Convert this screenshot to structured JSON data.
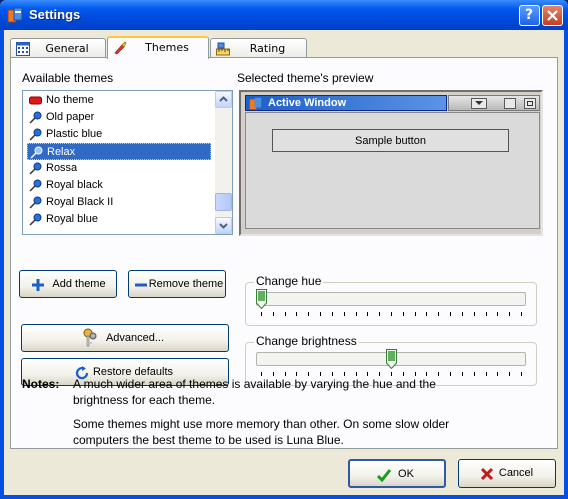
{
  "window": {
    "title": "Settings"
  },
  "tabs": [
    {
      "label": "General",
      "icon": "calendar-grid-icon",
      "active": false
    },
    {
      "label": "Themes",
      "icon": "paint-brush-icon",
      "active": true
    },
    {
      "label": "Rating",
      "icon": "ruler-icon",
      "active": false
    }
  ],
  "themes_panel": {
    "available_label": "Available themes",
    "preview_label": "Selected theme's preview",
    "items": [
      {
        "label": "No theme",
        "icon": "red-bar-icon"
      },
      {
        "label": "Old paper",
        "icon": "pushpin-icon"
      },
      {
        "label": "Plastic blue",
        "icon": "pushpin-icon"
      },
      {
        "label": "Relax",
        "icon": "pushpin-icon",
        "selected": true
      },
      {
        "label": "Rossa",
        "icon": "pushpin-icon"
      },
      {
        "label": "Royal black",
        "icon": "pushpin-icon"
      },
      {
        "label": "Royal Black II",
        "icon": "pushpin-icon"
      },
      {
        "label": "Royal blue",
        "icon": "pushpin-icon"
      }
    ],
    "add_button": "Add theme",
    "remove_button": "Remove theme",
    "advanced_button": "Advanced...",
    "restore_button": "Restore defaults",
    "preview": {
      "window_title": "Active Window",
      "sample_button": "Sample button"
    },
    "hue": {
      "label": "Change hue",
      "value_fraction": 0.0
    },
    "brightness": {
      "label": "Change brightness",
      "value_fraction": 0.5
    }
  },
  "notes": {
    "heading": "Notes:",
    "paragraphs": [
      "A much wider area of themes is available by varying the hue and the brightness for each theme.",
      "Some themes might use more memory than other. On some slow older computers the best theme to be used is Luna Blue."
    ]
  },
  "footer": {
    "ok": "OK",
    "cancel": "Cancel"
  },
  "colors": {
    "titlebar": "#0058ee",
    "selection": "#316ac5",
    "dialog_bg": "#ece9d8"
  }
}
